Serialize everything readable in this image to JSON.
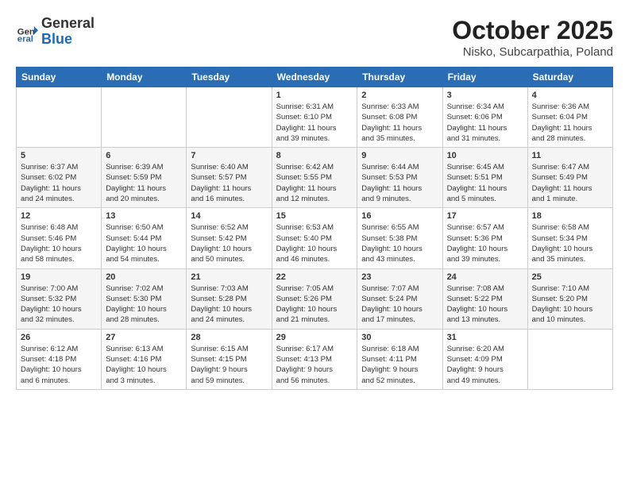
{
  "header": {
    "logo_general": "General",
    "logo_blue": "Blue",
    "month_title": "October 2025",
    "location": "Nisko, Subcarpathia, Poland"
  },
  "days_of_week": [
    "Sunday",
    "Monday",
    "Tuesday",
    "Wednesday",
    "Thursday",
    "Friday",
    "Saturday"
  ],
  "weeks": [
    [
      {
        "day": "",
        "info": ""
      },
      {
        "day": "",
        "info": ""
      },
      {
        "day": "",
        "info": ""
      },
      {
        "day": "1",
        "info": "Sunrise: 6:31 AM\nSunset: 6:10 PM\nDaylight: 11 hours\nand 39 minutes."
      },
      {
        "day": "2",
        "info": "Sunrise: 6:33 AM\nSunset: 6:08 PM\nDaylight: 11 hours\nand 35 minutes."
      },
      {
        "day": "3",
        "info": "Sunrise: 6:34 AM\nSunset: 6:06 PM\nDaylight: 11 hours\nand 31 minutes."
      },
      {
        "day": "4",
        "info": "Sunrise: 6:36 AM\nSunset: 6:04 PM\nDaylight: 11 hours\nand 28 minutes."
      }
    ],
    [
      {
        "day": "5",
        "info": "Sunrise: 6:37 AM\nSunset: 6:02 PM\nDaylight: 11 hours\nand 24 minutes."
      },
      {
        "day": "6",
        "info": "Sunrise: 6:39 AM\nSunset: 5:59 PM\nDaylight: 11 hours\nand 20 minutes."
      },
      {
        "day": "7",
        "info": "Sunrise: 6:40 AM\nSunset: 5:57 PM\nDaylight: 11 hours\nand 16 minutes."
      },
      {
        "day": "8",
        "info": "Sunrise: 6:42 AM\nSunset: 5:55 PM\nDaylight: 11 hours\nand 12 minutes."
      },
      {
        "day": "9",
        "info": "Sunrise: 6:44 AM\nSunset: 5:53 PM\nDaylight: 11 hours\nand 9 minutes."
      },
      {
        "day": "10",
        "info": "Sunrise: 6:45 AM\nSunset: 5:51 PM\nDaylight: 11 hours\nand 5 minutes."
      },
      {
        "day": "11",
        "info": "Sunrise: 6:47 AM\nSunset: 5:49 PM\nDaylight: 11 hours\nand 1 minute."
      }
    ],
    [
      {
        "day": "12",
        "info": "Sunrise: 6:48 AM\nSunset: 5:46 PM\nDaylight: 10 hours\nand 58 minutes."
      },
      {
        "day": "13",
        "info": "Sunrise: 6:50 AM\nSunset: 5:44 PM\nDaylight: 10 hours\nand 54 minutes."
      },
      {
        "day": "14",
        "info": "Sunrise: 6:52 AM\nSunset: 5:42 PM\nDaylight: 10 hours\nand 50 minutes."
      },
      {
        "day": "15",
        "info": "Sunrise: 6:53 AM\nSunset: 5:40 PM\nDaylight: 10 hours\nand 46 minutes."
      },
      {
        "day": "16",
        "info": "Sunrise: 6:55 AM\nSunset: 5:38 PM\nDaylight: 10 hours\nand 43 minutes."
      },
      {
        "day": "17",
        "info": "Sunrise: 6:57 AM\nSunset: 5:36 PM\nDaylight: 10 hours\nand 39 minutes."
      },
      {
        "day": "18",
        "info": "Sunrise: 6:58 AM\nSunset: 5:34 PM\nDaylight: 10 hours\nand 35 minutes."
      }
    ],
    [
      {
        "day": "19",
        "info": "Sunrise: 7:00 AM\nSunset: 5:32 PM\nDaylight: 10 hours\nand 32 minutes."
      },
      {
        "day": "20",
        "info": "Sunrise: 7:02 AM\nSunset: 5:30 PM\nDaylight: 10 hours\nand 28 minutes."
      },
      {
        "day": "21",
        "info": "Sunrise: 7:03 AM\nSunset: 5:28 PM\nDaylight: 10 hours\nand 24 minutes."
      },
      {
        "day": "22",
        "info": "Sunrise: 7:05 AM\nSunset: 5:26 PM\nDaylight: 10 hours\nand 21 minutes."
      },
      {
        "day": "23",
        "info": "Sunrise: 7:07 AM\nSunset: 5:24 PM\nDaylight: 10 hours\nand 17 minutes."
      },
      {
        "day": "24",
        "info": "Sunrise: 7:08 AM\nSunset: 5:22 PM\nDaylight: 10 hours\nand 13 minutes."
      },
      {
        "day": "25",
        "info": "Sunrise: 7:10 AM\nSunset: 5:20 PM\nDaylight: 10 hours\nand 10 minutes."
      }
    ],
    [
      {
        "day": "26",
        "info": "Sunrise: 6:12 AM\nSunset: 4:18 PM\nDaylight: 10 hours\nand 6 minutes."
      },
      {
        "day": "27",
        "info": "Sunrise: 6:13 AM\nSunset: 4:16 PM\nDaylight: 10 hours\nand 3 minutes."
      },
      {
        "day": "28",
        "info": "Sunrise: 6:15 AM\nSunset: 4:15 PM\nDaylight: 9 hours\nand 59 minutes."
      },
      {
        "day": "29",
        "info": "Sunrise: 6:17 AM\nSunset: 4:13 PM\nDaylight: 9 hours\nand 56 minutes."
      },
      {
        "day": "30",
        "info": "Sunrise: 6:18 AM\nSunset: 4:11 PM\nDaylight: 9 hours\nand 52 minutes."
      },
      {
        "day": "31",
        "info": "Sunrise: 6:20 AM\nSunset: 4:09 PM\nDaylight: 9 hours\nand 49 minutes."
      },
      {
        "day": "",
        "info": ""
      }
    ]
  ]
}
